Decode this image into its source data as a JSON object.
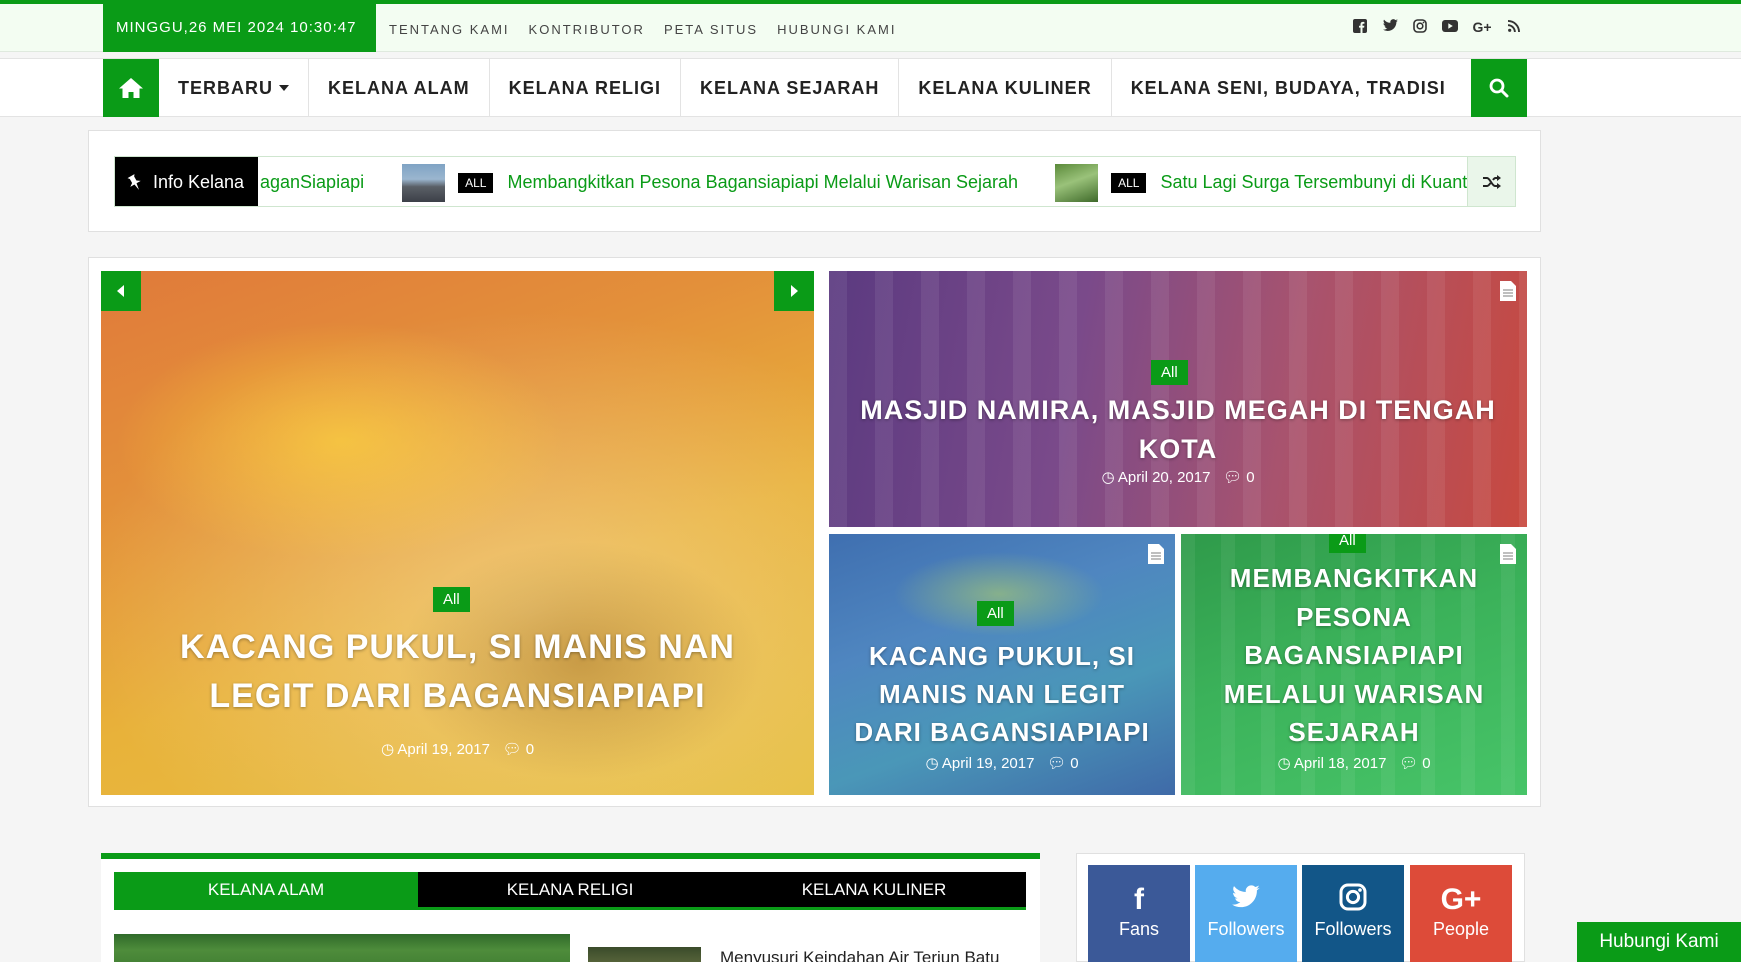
{
  "topbar": {
    "datetime": "MINGGU,26 MEI 2024 10:30:47",
    "links": [
      "TENTANG KAMI",
      "KONTRIBUTOR",
      "PETA SITUS",
      "HUBUNGI KAMI"
    ],
    "social_icons": [
      "facebook-icon",
      "twitter-icon",
      "instagram-icon",
      "youtube-icon",
      "google-plus-icon",
      "rss-icon"
    ]
  },
  "nav": {
    "items": [
      "TERBARU",
      "KELANA ALAM",
      "KELANA RELIGI",
      "KELANA SEJARAH",
      "KELANA KULINER",
      "KELANA SENI, BUDAYA, TRADISI"
    ],
    "home_icon": "home-icon",
    "search_icon": "search-icon"
  },
  "ticker": {
    "label": "Info Kelana",
    "fragment": "aganSiapiapi",
    "items": [
      {
        "badge": "ALL",
        "text": "Membangkitkan Pesona Bagansiapiapi Melalui Warisan Sejarah"
      },
      {
        "badge": "ALL",
        "text": "Satu Lagi Surga Tersembunyi di Kuantan"
      }
    ]
  },
  "featured": {
    "main": {
      "category": "All",
      "title": "KACANG PUKUL, SI MANIS NAN LEGIT DARI BAGANSIAPIAPI",
      "date": "April 19, 2017",
      "comments": "0"
    },
    "top_right": {
      "category": "All",
      "title": "MASJID NAMIRA, MASJID MEGAH DI TENGAH KOTA",
      "date": "April 20, 2017",
      "comments": "0"
    },
    "bottom_left": {
      "category": "All",
      "title": "KACANG PUKUL, SI MANIS NAN LEGIT DARI BAGANSIAPIAPI",
      "date": "April 19, 2017",
      "comments": "0"
    },
    "bottom_right": {
      "category": "All",
      "title": "MEMBANGKITKAN PESONA BAGANSIAPIAPI MELALUI WARISAN SEJARAH",
      "date": "April 18, 2017",
      "comments": "0"
    }
  },
  "tabs": {
    "items": [
      "KELANA ALAM",
      "KELANA RELIGI",
      "KELANA KULINER"
    ],
    "post_title": "Menyusuri Keindahan Air Terjun Batu"
  },
  "social_counters": [
    {
      "label": "Fans",
      "icon": "facebook-icon",
      "color": "#3b5998"
    },
    {
      "label": "Followers",
      "icon": "twitter-icon",
      "color": "#55acee"
    },
    {
      "label": "Followers",
      "icon": "instagram-icon",
      "color": "#125688"
    },
    {
      "label": "People",
      "icon": "google-plus-icon",
      "color": "#dd4b39"
    }
  ],
  "contact_button": "Hubungi Kami",
  "colors": {
    "brand": "#0a9b17"
  }
}
